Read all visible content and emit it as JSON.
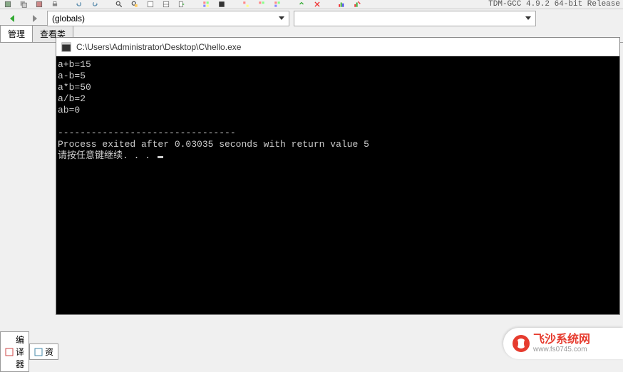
{
  "toolbar": {
    "compiler_info": "TDM-GCC 4.9.2 64-bit Release"
  },
  "dropdowns": {
    "globals": "(globals)",
    "secondary": ""
  },
  "left_tabs": {
    "tab1": "管理",
    "tab2": "查看类"
  },
  "console": {
    "title": "C:\\Users\\Administrator\\Desktop\\C\\hello.exe",
    "lines": {
      "l1": "a+b=15",
      "l2": "a-b=5",
      "l3": "a*b=50",
      "l4": "a/b=2",
      "l5": "ab=0",
      "sep": "--------------------------------",
      "exit": "Process exited after 0.03035 seconds with return value 5",
      "continue": "请按任意键继续. . . "
    }
  },
  "bottom_tabs": {
    "compiler": "编译器",
    "resources": "资"
  },
  "watermark": {
    "main": "飞沙系统网",
    "sub": "www.fs0745.com"
  }
}
